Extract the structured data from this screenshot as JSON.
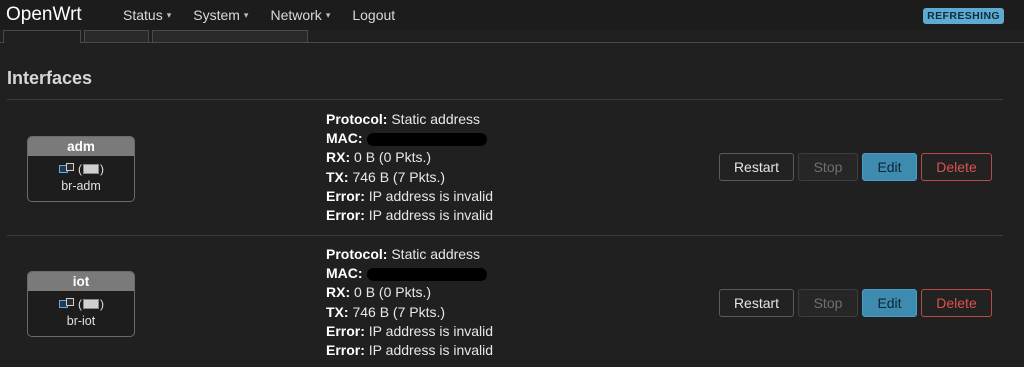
{
  "header": {
    "brand": "OpenWrt",
    "menu": [
      {
        "label": "Status",
        "has_dropdown": true
      },
      {
        "label": "System",
        "has_dropdown": true
      },
      {
        "label": "Network",
        "has_dropdown": true
      },
      {
        "label": "Logout",
        "has_dropdown": false
      }
    ],
    "badge": "REFRESHING",
    "badge_color": "#5dabd1"
  },
  "page": {
    "title": "Interfaces"
  },
  "interfaces": [
    {
      "name": "adm",
      "device": "br-adm",
      "protocol_label": "Protocol:",
      "protocol": "Static address",
      "mac_label": "MAC:",
      "rx_label": "RX:",
      "rx": "0 B (0 Pkts.)",
      "tx_label": "TX:",
      "tx": "746 B (7 Pkts.)",
      "errors": [
        {
          "label": "Error:",
          "text": "IP address is invalid"
        },
        {
          "label": "Error:",
          "text": "IP address is invalid"
        }
      ],
      "buttons": {
        "restart": "Restart",
        "stop": "Stop",
        "edit": "Edit",
        "delete": "Delete"
      }
    },
    {
      "name": "iot",
      "device": "br-iot",
      "protocol_label": "Protocol:",
      "protocol": "Static address",
      "mac_label": "MAC:",
      "rx_label": "RX:",
      "rx": "0 B (0 Pkts.)",
      "tx_label": "TX:",
      "tx": "746 B (7 Pkts.)",
      "errors": [
        {
          "label": "Error:",
          "text": "IP address is invalid"
        },
        {
          "label": "Error:",
          "text": "IP address is invalid"
        }
      ],
      "buttons": {
        "restart": "Restart",
        "stop": "Stop",
        "edit": "Edit",
        "delete": "Delete"
      }
    }
  ],
  "icons": {
    "caret": "▾",
    "port": "ethernet-port-icon",
    "wifi_left": "(",
    "wifi_right": ")"
  },
  "colors": {
    "edit_button": "#3e8bb0",
    "delete_text": "#d9534f",
    "background": "#202020"
  }
}
